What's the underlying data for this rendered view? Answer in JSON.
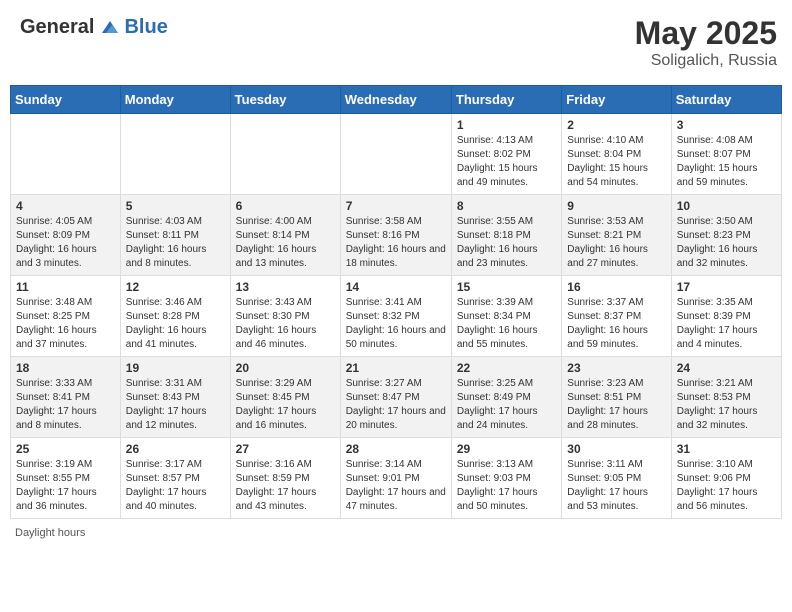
{
  "header": {
    "logo_general": "General",
    "logo_blue": "Blue",
    "month_year": "May 2025",
    "location": "Soligalich, Russia"
  },
  "footer": {
    "daylight_label": "Daylight hours"
  },
  "weekdays": [
    "Sunday",
    "Monday",
    "Tuesday",
    "Wednesday",
    "Thursday",
    "Friday",
    "Saturday"
  ],
  "weeks": [
    [
      {
        "day": "",
        "sunrise": "",
        "sunset": "",
        "daylight": ""
      },
      {
        "day": "",
        "sunrise": "",
        "sunset": "",
        "daylight": ""
      },
      {
        "day": "",
        "sunrise": "",
        "sunset": "",
        "daylight": ""
      },
      {
        "day": "",
        "sunrise": "",
        "sunset": "",
        "daylight": ""
      },
      {
        "day": "1",
        "sunrise": "Sunrise: 4:13 AM",
        "sunset": "Sunset: 8:02 PM",
        "daylight": "Daylight: 15 hours and 49 minutes."
      },
      {
        "day": "2",
        "sunrise": "Sunrise: 4:10 AM",
        "sunset": "Sunset: 8:04 PM",
        "daylight": "Daylight: 15 hours and 54 minutes."
      },
      {
        "day": "3",
        "sunrise": "Sunrise: 4:08 AM",
        "sunset": "Sunset: 8:07 PM",
        "daylight": "Daylight: 15 hours and 59 minutes."
      }
    ],
    [
      {
        "day": "4",
        "sunrise": "Sunrise: 4:05 AM",
        "sunset": "Sunset: 8:09 PM",
        "daylight": "Daylight: 16 hours and 3 minutes."
      },
      {
        "day": "5",
        "sunrise": "Sunrise: 4:03 AM",
        "sunset": "Sunset: 8:11 PM",
        "daylight": "Daylight: 16 hours and 8 minutes."
      },
      {
        "day": "6",
        "sunrise": "Sunrise: 4:00 AM",
        "sunset": "Sunset: 8:14 PM",
        "daylight": "Daylight: 16 hours and 13 minutes."
      },
      {
        "day": "7",
        "sunrise": "Sunrise: 3:58 AM",
        "sunset": "Sunset: 8:16 PM",
        "daylight": "Daylight: 16 hours and 18 minutes."
      },
      {
        "day": "8",
        "sunrise": "Sunrise: 3:55 AM",
        "sunset": "Sunset: 8:18 PM",
        "daylight": "Daylight: 16 hours and 23 minutes."
      },
      {
        "day": "9",
        "sunrise": "Sunrise: 3:53 AM",
        "sunset": "Sunset: 8:21 PM",
        "daylight": "Daylight: 16 hours and 27 minutes."
      },
      {
        "day": "10",
        "sunrise": "Sunrise: 3:50 AM",
        "sunset": "Sunset: 8:23 PM",
        "daylight": "Daylight: 16 hours and 32 minutes."
      }
    ],
    [
      {
        "day": "11",
        "sunrise": "Sunrise: 3:48 AM",
        "sunset": "Sunset: 8:25 PM",
        "daylight": "Daylight: 16 hours and 37 minutes."
      },
      {
        "day": "12",
        "sunrise": "Sunrise: 3:46 AM",
        "sunset": "Sunset: 8:28 PM",
        "daylight": "Daylight: 16 hours and 41 minutes."
      },
      {
        "day": "13",
        "sunrise": "Sunrise: 3:43 AM",
        "sunset": "Sunset: 8:30 PM",
        "daylight": "Daylight: 16 hours and 46 minutes."
      },
      {
        "day": "14",
        "sunrise": "Sunrise: 3:41 AM",
        "sunset": "Sunset: 8:32 PM",
        "daylight": "Daylight: 16 hours and 50 minutes."
      },
      {
        "day": "15",
        "sunrise": "Sunrise: 3:39 AM",
        "sunset": "Sunset: 8:34 PM",
        "daylight": "Daylight: 16 hours and 55 minutes."
      },
      {
        "day": "16",
        "sunrise": "Sunrise: 3:37 AM",
        "sunset": "Sunset: 8:37 PM",
        "daylight": "Daylight: 16 hours and 59 minutes."
      },
      {
        "day": "17",
        "sunrise": "Sunrise: 3:35 AM",
        "sunset": "Sunset: 8:39 PM",
        "daylight": "Daylight: 17 hours and 4 minutes."
      }
    ],
    [
      {
        "day": "18",
        "sunrise": "Sunrise: 3:33 AM",
        "sunset": "Sunset: 8:41 PM",
        "daylight": "Daylight: 17 hours and 8 minutes."
      },
      {
        "day": "19",
        "sunrise": "Sunrise: 3:31 AM",
        "sunset": "Sunset: 8:43 PM",
        "daylight": "Daylight: 17 hours and 12 minutes."
      },
      {
        "day": "20",
        "sunrise": "Sunrise: 3:29 AM",
        "sunset": "Sunset: 8:45 PM",
        "daylight": "Daylight: 17 hours and 16 minutes."
      },
      {
        "day": "21",
        "sunrise": "Sunrise: 3:27 AM",
        "sunset": "Sunset: 8:47 PM",
        "daylight": "Daylight: 17 hours and 20 minutes."
      },
      {
        "day": "22",
        "sunrise": "Sunrise: 3:25 AM",
        "sunset": "Sunset: 8:49 PM",
        "daylight": "Daylight: 17 hours and 24 minutes."
      },
      {
        "day": "23",
        "sunrise": "Sunrise: 3:23 AM",
        "sunset": "Sunset: 8:51 PM",
        "daylight": "Daylight: 17 hours and 28 minutes."
      },
      {
        "day": "24",
        "sunrise": "Sunrise: 3:21 AM",
        "sunset": "Sunset: 8:53 PM",
        "daylight": "Daylight: 17 hours and 32 minutes."
      }
    ],
    [
      {
        "day": "25",
        "sunrise": "Sunrise: 3:19 AM",
        "sunset": "Sunset: 8:55 PM",
        "daylight": "Daylight: 17 hours and 36 minutes."
      },
      {
        "day": "26",
        "sunrise": "Sunrise: 3:17 AM",
        "sunset": "Sunset: 8:57 PM",
        "daylight": "Daylight: 17 hours and 40 minutes."
      },
      {
        "day": "27",
        "sunrise": "Sunrise: 3:16 AM",
        "sunset": "Sunset: 8:59 PM",
        "daylight": "Daylight: 17 hours and 43 minutes."
      },
      {
        "day": "28",
        "sunrise": "Sunrise: 3:14 AM",
        "sunset": "Sunset: 9:01 PM",
        "daylight": "Daylight: 17 hours and 47 minutes."
      },
      {
        "day": "29",
        "sunrise": "Sunrise: 3:13 AM",
        "sunset": "Sunset: 9:03 PM",
        "daylight": "Daylight: 17 hours and 50 minutes."
      },
      {
        "day": "30",
        "sunrise": "Sunrise: 3:11 AM",
        "sunset": "Sunset: 9:05 PM",
        "daylight": "Daylight: 17 hours and 53 minutes."
      },
      {
        "day": "31",
        "sunrise": "Sunrise: 3:10 AM",
        "sunset": "Sunset: 9:06 PM",
        "daylight": "Daylight: 17 hours and 56 minutes."
      }
    ]
  ]
}
